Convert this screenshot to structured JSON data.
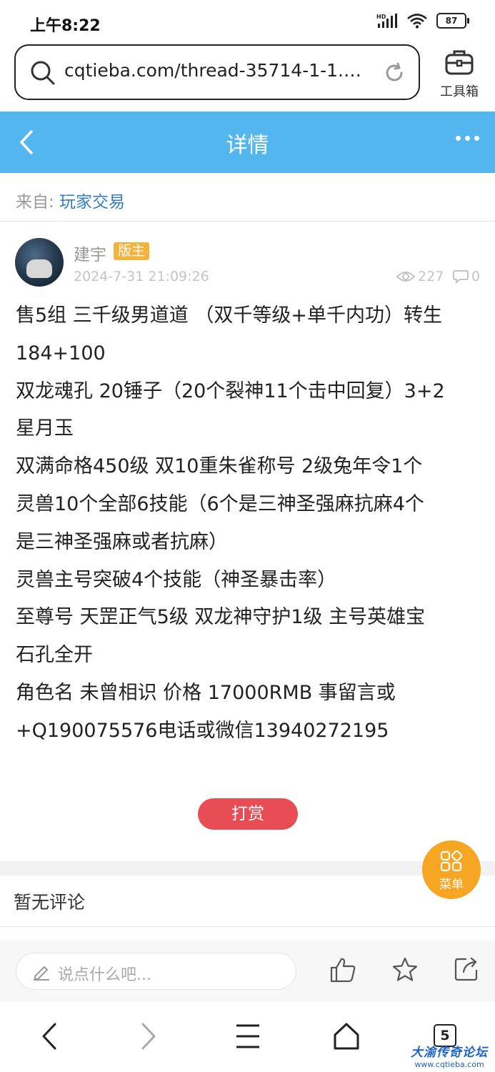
{
  "status_bar": {
    "time": "上午8:22",
    "network": "HD",
    "battery": "87"
  },
  "browser": {
    "url": "cqtieba.com/thread-35714-1-1.h...",
    "toolbox_label": "工具箱",
    "nav": {
      "tabs_count": "5"
    }
  },
  "header": {
    "title": "详情"
  },
  "from": {
    "prefix": "来自:",
    "forum": "玩家交易"
  },
  "post": {
    "author": "建宇",
    "badge": "版主",
    "time": "2024-7-31 21:09:26",
    "views": "227",
    "comments": "0",
    "lines": [
      "售5组 三千级男道道 （双千等级+单千内功）转生",
      "184+100",
      "双龙魂孔 20锤子（20个裂神11个击中回复）3+2",
      "星月玉",
      "双满命格450级 双10重朱雀称号  2级兔年令1个",
      "灵兽10个全部6技能（6个是三神圣强麻抗麻4个",
      "是三神圣强麻或者抗麻）",
      "灵兽主号突破4个技能（神圣暴击率）",
      "至尊号 天罡正气5级 双龙神守护1级 主号英雄宝",
      "石孔全开",
      "角色名  未曾相识   价格  17000RMB  事留言或",
      "+Q190075576电话或微信13940272195"
    ],
    "reward_label": "打赏"
  },
  "menu_fab": {
    "label": "菜单"
  },
  "comments_section": {
    "empty_text": "暂无评论"
  },
  "comment_bar": {
    "placeholder": "说点什么吧..."
  },
  "watermark": {
    "title": "大渝传奇论坛",
    "url": "www.cqtieba.com"
  },
  "colors": {
    "header_bg": "#53b6ee",
    "badge": "#f4b33d",
    "reward": "#e84c55",
    "menu_fab": "#f6a623",
    "link": "#2f7fc9"
  }
}
